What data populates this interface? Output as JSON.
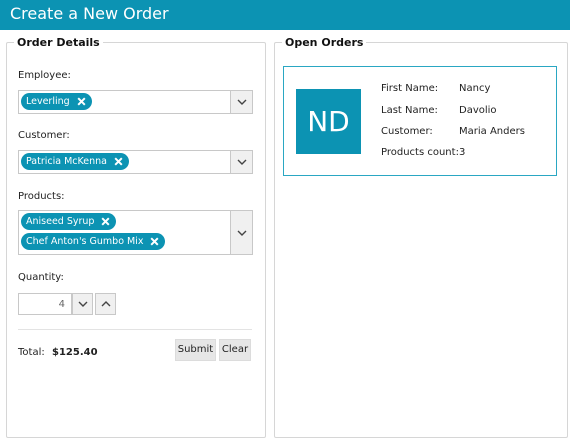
{
  "header": {
    "title": "Create a New Order"
  },
  "order_details": {
    "legend": "Order Details",
    "employee": {
      "label": "Employee:",
      "tokens": [
        "Leverling"
      ]
    },
    "customer": {
      "label": "Customer:",
      "tokens": [
        "Patricia McKenna"
      ]
    },
    "products": {
      "label": "Products:",
      "tokens": [
        "Aniseed Syrup",
        "Chef Anton's Gumbo Mix"
      ]
    },
    "quantity": {
      "label": "Quantity:",
      "value": "4"
    },
    "total": {
      "label": "Total:",
      "value": "$125.40"
    },
    "buttons": {
      "submit": "Submit",
      "clear": "Clear"
    }
  },
  "open_orders": {
    "legend": "Open Orders",
    "card": {
      "initials": "ND",
      "fields": [
        {
          "label": "First Name:",
          "value": "Nancy"
        },
        {
          "label": "Last Name:",
          "value": "Davolio"
        },
        {
          "label": "Customer:",
          "value": "Maria Anders"
        },
        {
          "label": "Products count:",
          "value": "3"
        }
      ]
    }
  },
  "colors": {
    "accent": "#0c93b3",
    "card_border": "#2aa7c3"
  },
  "icons": [
    "chevron-down-icon",
    "chevron-up-icon",
    "remove-token-icon"
  ]
}
